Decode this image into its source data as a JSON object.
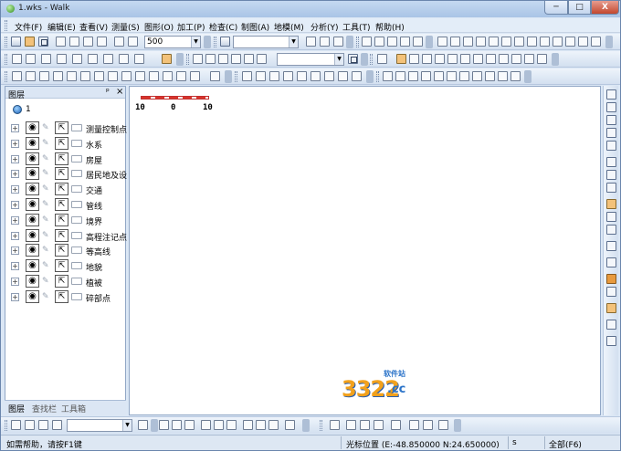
{
  "window": {
    "title": "1.wks - Walk",
    "min_label": "─",
    "max_label": "□",
    "close_label": "X"
  },
  "menu": [
    "文件(F)",
    "编辑(E)",
    "查看(V)",
    "测量(S)",
    "图形(O)",
    "加工(P)",
    "检查(C)",
    "制图(A)",
    "地模(M)",
    "分析(Y)",
    "工具(T)",
    "帮助(H)"
  ],
  "toolbar": {
    "scale_value": "500",
    "combo_arrow": "▼"
  },
  "layers_panel": {
    "title": "图层",
    "pin": "ᵖ",
    "close": "×",
    "root_label": "1",
    "expand_symbol": "+",
    "eye_symbol": "◉",
    "select_symbol": "⇱",
    "layers": [
      "测量控制点",
      "水系",
      "房屋",
      "居民地及设",
      "交通",
      "管线",
      "境界",
      "高程注记点",
      "等高线",
      "地貌",
      "植被",
      "碎部点"
    ],
    "tabs": [
      "图层",
      "查找栏",
      "工具箱"
    ]
  },
  "canvas": {
    "scale_labels": [
      "10",
      "0",
      "10"
    ],
    "watermark": {
      "number": "3322",
      "domain": ".cc",
      "site": "软件站"
    }
  },
  "status": {
    "help": "如需帮助，请按F1键",
    "coords": "光标位置 (E:-48.850000  N:24.650000)",
    "mode": "s",
    "scope": "全部(F6)"
  }
}
